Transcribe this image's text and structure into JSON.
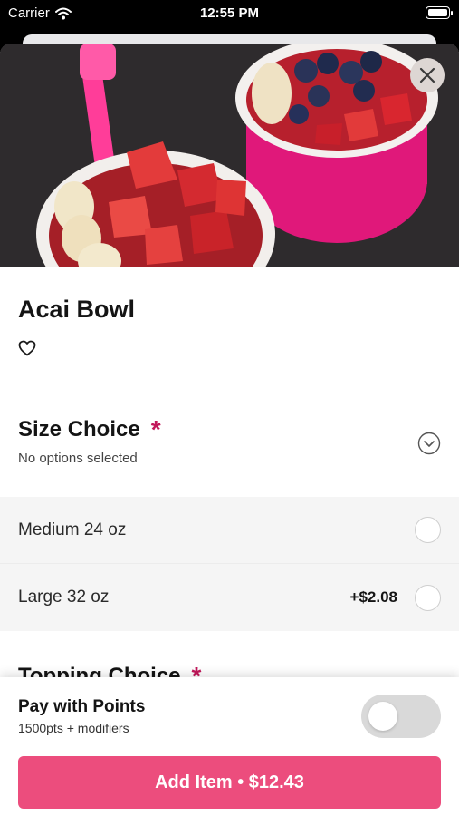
{
  "status_bar": {
    "carrier": "Carrier",
    "time": "12:55 PM"
  },
  "product": {
    "title": "Acai Bowl",
    "favorite_icon": "heart-icon"
  },
  "size_choice": {
    "title": "Size Choice",
    "required_mark": "*",
    "subtitle": "No options selected",
    "options": [
      {
        "label": "Medium 24 oz",
        "price": ""
      },
      {
        "label": "Large 32 oz",
        "price": "+$2.08"
      }
    ]
  },
  "topping_choice": {
    "title": "Topping Choice",
    "required_mark": "*"
  },
  "points": {
    "title": "Pay with Points",
    "subtitle": "1500pts + modifiers",
    "enabled": false
  },
  "add_button": {
    "label": "Add Item • $12.43"
  },
  "colors": {
    "accent": "#ec4d7d",
    "required": "#c2185b"
  }
}
